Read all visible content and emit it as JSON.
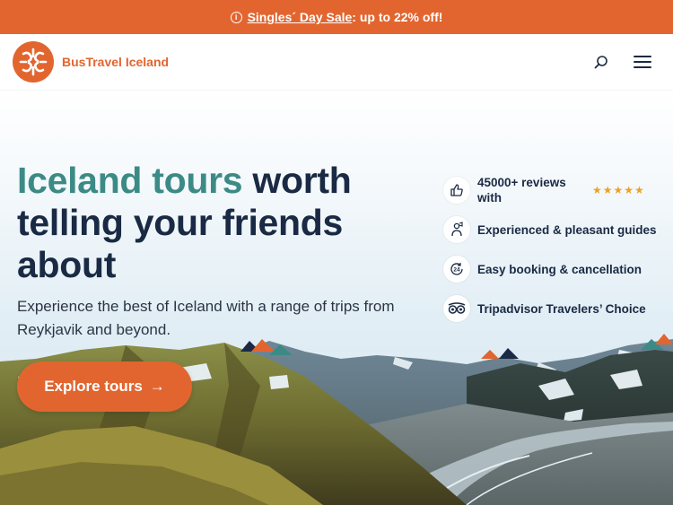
{
  "promo": {
    "icon": "info-icon",
    "sale_link": "Singles´ Day Sale",
    "sale_rest": ": up to 22% off!",
    "color": "#e2652f"
  },
  "header": {
    "logo_text": "BusTravel Iceland",
    "logo_icon": "bustravel-logo-icon",
    "search_icon": "search-icon",
    "menu_icon": "hamburger-menu-icon"
  },
  "hero": {
    "title_accent": "Iceland tours",
    "title_rest": " worth telling your friends about",
    "subtitle": "Experience the best of Iceland with a range of trips from Reykjavik and beyond.",
    "cta_label": "Explore tours",
    "cta_icon": "arrow-right-icon"
  },
  "features": [
    {
      "icon": "thumbs-up-icon",
      "text": "45000+ reviews with",
      "stars": "★★★★★",
      "rating": 5
    },
    {
      "icon": "guide-icon",
      "text": "Experienced & pleasant guides"
    },
    {
      "icon": "24h-icon",
      "text": "Easy booking & cancellation"
    },
    {
      "icon": "tripadvisor-icon",
      "text": "Tripadvisor Travelers’ Choice"
    }
  ],
  "colors": {
    "accent": "#e2652f",
    "title_accent": "#3c8a86",
    "title": "#1a2a44",
    "star": "#f0a023"
  }
}
